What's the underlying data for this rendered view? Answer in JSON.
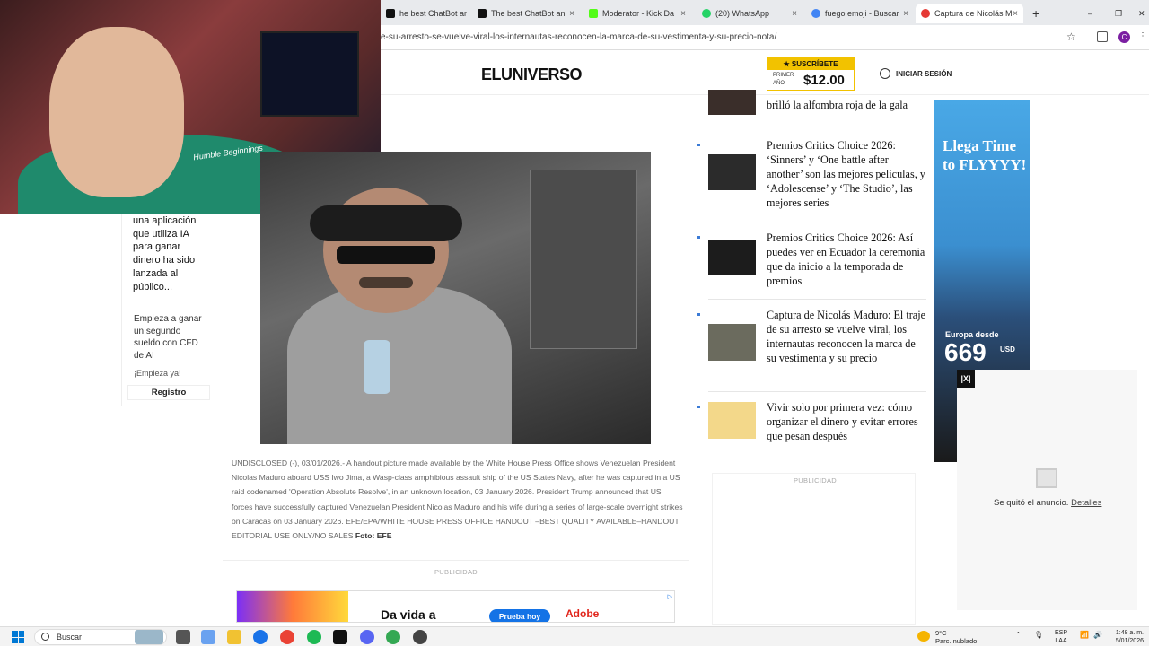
{
  "browser": {
    "tabs": [
      {
        "label": "he best ChatBot an",
        "color": "#111111"
      },
      {
        "label": "The best ChatBot an",
        "color": "#111111"
      },
      {
        "label": "Moderator - Kick Da",
        "color": "#53fc18"
      },
      {
        "label": "(20) WhatsApp",
        "color": "#25d366"
      },
      {
        "label": "fuego emoji - Buscar",
        "color": "#4285f4"
      },
      {
        "label": "Captura de Nicolás M",
        "color": "#e53935"
      }
    ],
    "url": "e-su-arresto-se-vuelve-viral-los-internautas-reconocen-la-marca-de-su-vestimenta-y-su-precio-nota/",
    "profile_initial": "C"
  },
  "webcam": {
    "hoodie_text": "Humble Beginnings"
  },
  "site": {
    "logo": "ELUNIVERSO",
    "subscribe_label": "SUSCRÍBETE",
    "subscribe_small": "PRIMER AÑO",
    "subscribe_price": "$12.00",
    "login_label": "INICIAR SESIÓN"
  },
  "left_ad": {
    "title": "una aplicación que utiliza IA para ganar dinero ha sido lanzada al público...",
    "desc": "Empieza a ganar un segundo sueldo con CFD de AI",
    "cta": "¡Empieza ya!",
    "button": "Registro"
  },
  "article": {
    "caption": "UNDISCLOSED (-), 03/01/2026.- A handout picture made available by the White House Press Office shows Venezuelan President Nicolas Maduro aboard USS Iwo Jima, a Wasp-class amphibious assault ship of the US States Navy, after he was captured in a US raid codenamed 'Operation Absolute Resolve', in an unknown location, 03 January 2026. President Trump announced that US forces have successfully captured Venezuelan President Nicolas Maduro and his wife during a series of large-scale overnight strikes on Caracas on 03 January 2026. EFE/EPA/WHITE HOUSE PRESS OFFICE HANDOUT –BEST QUALITY AVAILABLE–HANDOUT EDITORIAL USE ONLY/NO SALES",
    "photo_credit": "Foto: EFE",
    "publicidad": "PUBLICIDAD"
  },
  "bottom_ad": {
    "headline": "Da vida a",
    "button": "Prueba hoy",
    "brand": "Adobe"
  },
  "related": [
    {
      "text": "brilló la alfombra roja de la gala"
    },
    {
      "text": "Premios Critics Choice 2026: ‘Sinners’ y ‘One battle after another’ son las mejores películas, y ‘Adolescense’ y ‘The Studio’, las mejores series"
    },
    {
      "text": "Premios Critics Choice 2026: Así puedes ver en Ecuador la ceremonia que da inicio a la temporada de premios"
    },
    {
      "text": "Captura de Nicolás Maduro: El traje de su arresto se vuelve viral, los internautas reconocen la marca de su vestimenta y su precio"
    },
    {
      "text": "Vivir solo por primera vez: cómo organizar el dinero y evitar errores que pesan después"
    }
  ],
  "side_ad": {
    "headline": "Llega Time to FLYYYY!",
    "europe": "Europa desde",
    "price": "669",
    "currency": "USD"
  },
  "closed_ad": {
    "message": "Se quitó el anuncio.",
    "details": "Detalles",
    "badge": "|X|"
  },
  "publicidad_right": "PUBLICIDAD",
  "taskbar": {
    "search": "Buscar",
    "temp": "9°C",
    "weather": "Parc. nublado",
    "lang1": "ESP",
    "lang2": "LAA",
    "time": "1:48 a. m.",
    "date": "5/01/2026"
  }
}
